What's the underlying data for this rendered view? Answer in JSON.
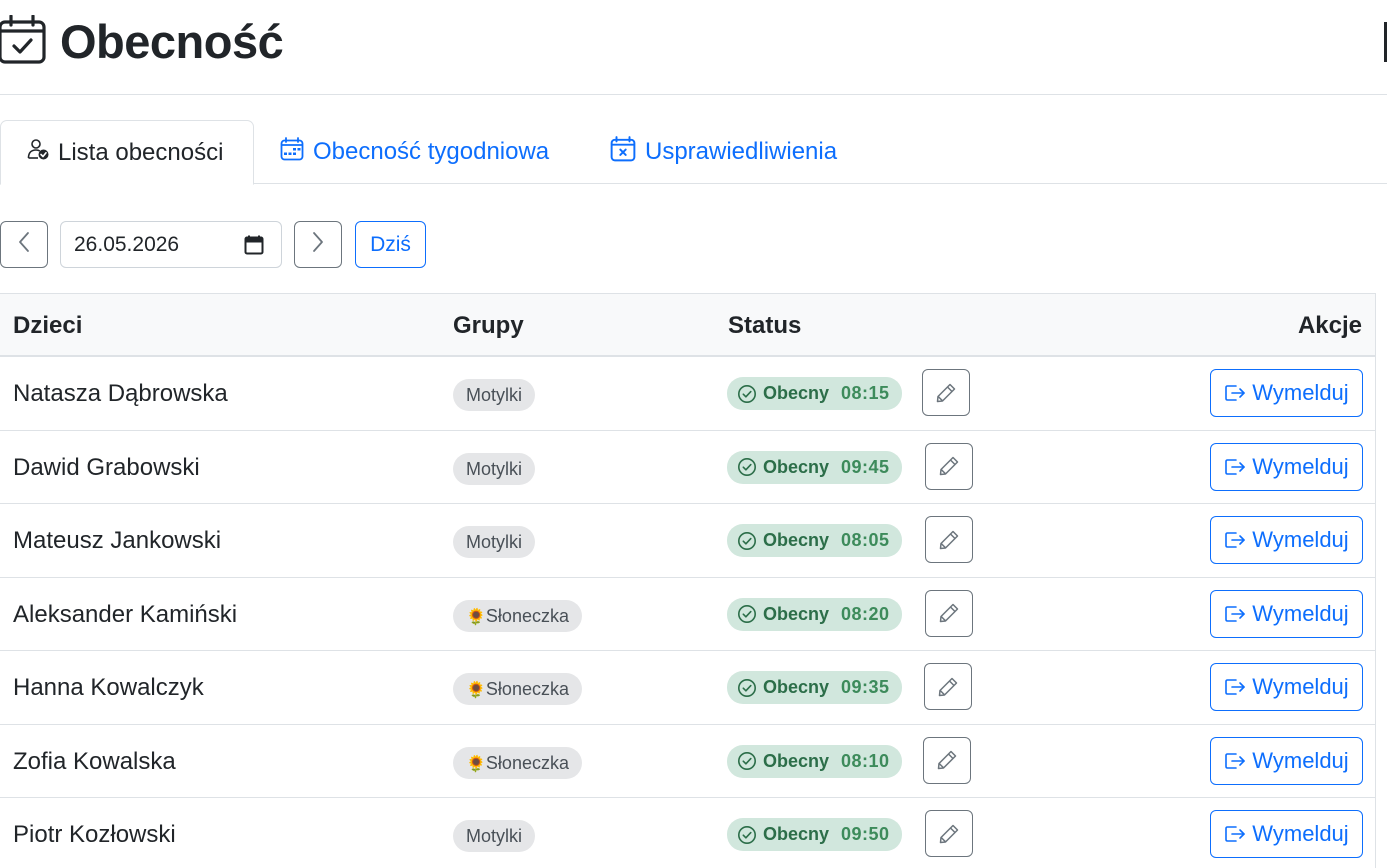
{
  "header": {
    "title": "Obecność",
    "icon": "calendar-check-icon"
  },
  "tabs": [
    {
      "label": "Lista obecności",
      "icon": "person-check-icon",
      "active": true
    },
    {
      "label": "Obecność tygodniowa",
      "icon": "calendar-week-icon",
      "active": false
    },
    {
      "label": "Usprawiedliwienia",
      "icon": "calendar-x-icon",
      "active": false
    }
  ],
  "date_nav": {
    "date_value": "26.05.2026",
    "today_label": "Dziś"
  },
  "table": {
    "headers": {
      "children": "Dzieci",
      "groups": "Grupy",
      "status": "Status",
      "actions": "Akcje"
    },
    "rows": [
      {
        "name": "Natasza Dąbrowska",
        "group": "Motylki",
        "group_emoji": "",
        "status": "Obecny",
        "time": "08:15",
        "action": "Wymelduj"
      },
      {
        "name": "Dawid Grabowski",
        "group": "Motylki",
        "group_emoji": "",
        "status": "Obecny",
        "time": "09:45",
        "action": "Wymelduj"
      },
      {
        "name": "Mateusz Jankowski",
        "group": "Motylki",
        "group_emoji": "",
        "status": "Obecny",
        "time": "08:05",
        "action": "Wymelduj"
      },
      {
        "name": "Aleksander Kamiński",
        "group": "Słoneczka",
        "group_emoji": "🌻",
        "status": "Obecny",
        "time": "08:20",
        "action": "Wymelduj"
      },
      {
        "name": "Hanna Kowalczyk",
        "group": "Słoneczka",
        "group_emoji": "🌻",
        "status": "Obecny",
        "time": "09:35",
        "action": "Wymelduj"
      },
      {
        "name": "Zofia Kowalska",
        "group": "Słoneczka",
        "group_emoji": "🌻",
        "status": "Obecny",
        "time": "08:10",
        "action": "Wymelduj"
      },
      {
        "name": "Piotr Kozłowski",
        "group": "Motylki",
        "group_emoji": "",
        "status": "Obecny",
        "time": "09:50",
        "action": "Wymelduj"
      }
    ]
  },
  "colors": {
    "primary": "#0d6efd",
    "success_bg": "#d1e7dd",
    "success_text": "#2c6e49",
    "badge_bg": "#e5e6e8",
    "border": "#dee2e6"
  }
}
